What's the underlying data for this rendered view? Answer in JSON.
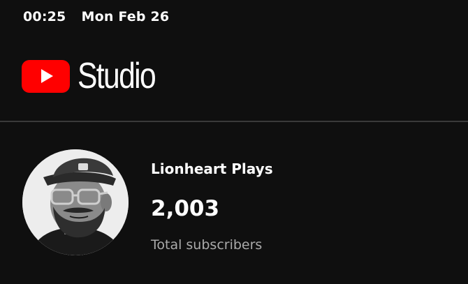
{
  "status_bar": {
    "time": "00:25",
    "date": "Mon Feb 26"
  },
  "header": {
    "logo_icon": "youtube-play-icon",
    "brand_color": "#ff0000",
    "title": "Studio"
  },
  "channel": {
    "name": "Lionheart Plays",
    "subscriber_count": "2,003",
    "subscriber_label": "Total subscribers"
  }
}
